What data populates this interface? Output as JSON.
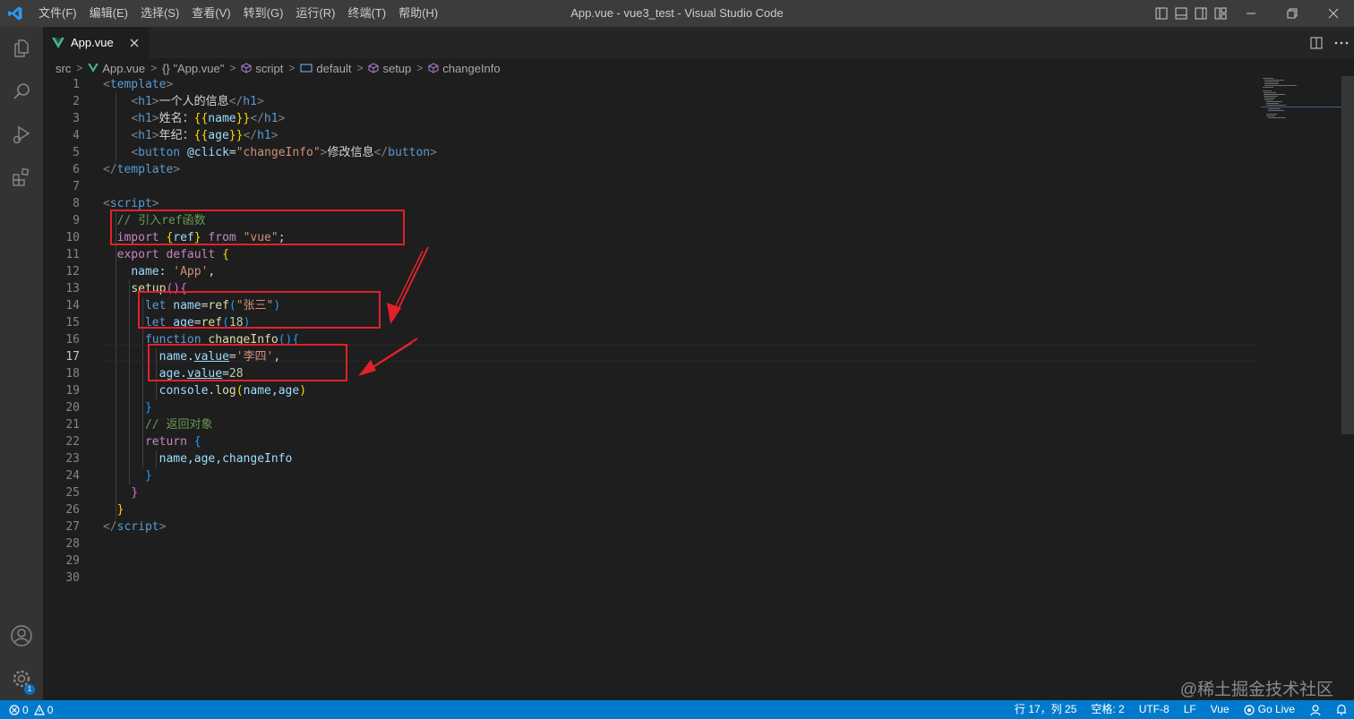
{
  "window": {
    "title": "App.vue - vue3_test - Visual Studio Code",
    "menu": [
      "文件(F)",
      "编辑(E)",
      "选择(S)",
      "查看(V)",
      "转到(G)",
      "运行(R)",
      "终端(T)",
      "帮助(H)"
    ]
  },
  "tab": {
    "name": "App.vue",
    "close": "✕"
  },
  "breadcrumb": [
    "src",
    "App.vue",
    "{} \"App.vue\"",
    "script",
    "default",
    "setup",
    "changeInfo"
  ],
  "code": {
    "line_numbers": [
      "1",
      "2",
      "3",
      "4",
      "5",
      "6",
      "7",
      "8",
      "9",
      "10",
      "11",
      "12",
      "13",
      "14",
      "15",
      "16",
      "17",
      "18",
      "19",
      "20",
      "21",
      "22",
      "23",
      "24",
      "25",
      "26",
      "27",
      "28",
      "29",
      "30"
    ],
    "active_line": "17",
    "l1": "template",
    "l2_h1": "h1",
    "l2_text": "一个人的信息",
    "l3_text": "姓名：",
    "l3_var": "name",
    "l4_text": "年纪：",
    "l4_var": "age",
    "l5_tag": "button",
    "l5_attr": "@click",
    "l5_val": "\"changeInfo\"",
    "l5_text": "修改信息",
    "l8": "script",
    "l9": "// 引入ref函数",
    "l10_import": "import",
    "l10_ref": "ref",
    "l10_from": "from",
    "l10_mod": "\"vue\"",
    "l11_export": "export",
    "l11_default": "default",
    "l12_key": "name",
    "l12_val": "'App'",
    "l13_fn": "setup",
    "l14_let": "let",
    "l14_var": "name",
    "l14_fn": "ref",
    "l14_val": "\"张三\"",
    "l15_let": "let",
    "l15_var": "age",
    "l15_fn": "ref",
    "l15_val": "18",
    "l16_kw": "function",
    "l16_fn": "changeInfo",
    "l17_obj": "name",
    "l17_prop": "value",
    "l17_val": "'李四'",
    "l18_obj": "age",
    "l18_prop": "value",
    "l18_val": "28",
    "l19_obj": "console",
    "l19_fn": "log",
    "l19_args": "name,age",
    "l21": "// 返回对象",
    "l22_kw": "return",
    "l23": "name,age,changeInfo"
  },
  "statusbar": {
    "errors": "0",
    "warnings": "0",
    "position": "行 17，列 25",
    "spaces": "空格: 2",
    "encoding": "UTF-8",
    "eol": "LF",
    "language": "Vue",
    "golive": "Go Live"
  },
  "badge": "1",
  "watermark": "@稀土掘金技术社区",
  "colors": {
    "accent": "#007acc",
    "highlight_box": "#e0212a",
    "vue_green": "#41b883"
  }
}
